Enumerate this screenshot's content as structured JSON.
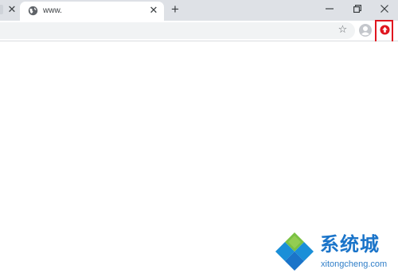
{
  "tabstrip": {
    "prev_tab_close": "✕",
    "active_tab": {
      "title": "www.",
      "close": "✕",
      "icon": "globe-icon"
    },
    "new_tab": "+"
  },
  "window_controls": {
    "minimize": "—",
    "restore": "❐",
    "close": "✕"
  },
  "toolbar": {
    "bookmark_icon": "☆",
    "profile_icon": "profile-icon",
    "extension_icon": "extension-icon",
    "extension_color": "#e0161f",
    "highlight_color": "#e0161f"
  },
  "watermark": {
    "text": "系统城",
    "url": "xitongcheng.com"
  }
}
